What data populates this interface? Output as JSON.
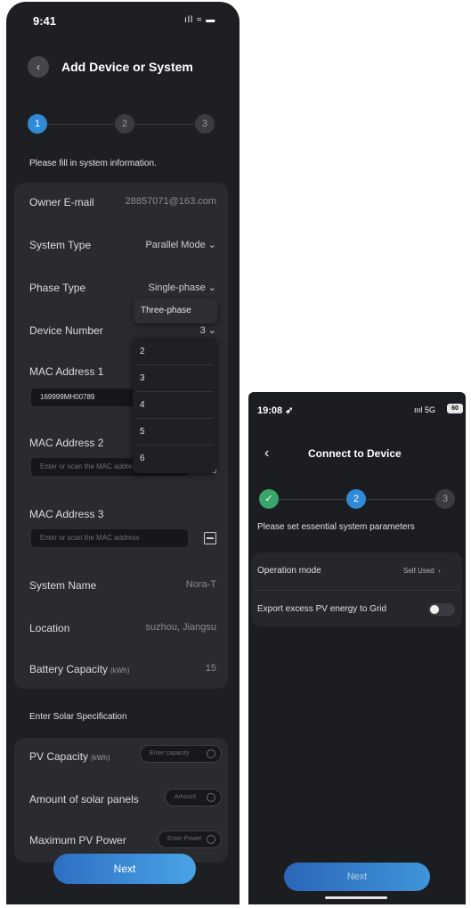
{
  "left": {
    "status": {
      "time": "9:41",
      "icons": "ıll ≈ ▬"
    },
    "header": {
      "back_icon": "‹",
      "title": "Add Device or System"
    },
    "steps": [
      "1",
      "2",
      "3"
    ],
    "hint": "Please fill in system information.",
    "fields": {
      "owner_label": "Owner E-mail",
      "owner_value": "28857071@163.com",
      "system_type_label": "System Type",
      "system_type_value": "Parallel Mode",
      "phase_type_label": "Phase Type",
      "phase_type_value": "Single-phase",
      "device_number_label": "Device Number",
      "device_number_value": "3",
      "mac1_label": "MAC Address 1",
      "mac1_value": "169999MH00789",
      "mac2_label": "MAC Address 2",
      "mac2_placeholder": "Enter or scan the MAC address",
      "mac3_label": "MAC Address 3",
      "mac3_placeholder": "Enter or scan the MAC address",
      "system_name_label": "System Name",
      "system_name_value": "Nora-T",
      "location_label": "Location",
      "location_value": "suzhou, Jiangsu",
      "battery_label": "Battery Capacity",
      "battery_unit": "(kWh)",
      "battery_value": "15"
    },
    "phase_dropdown_option": "Three-phase",
    "device_number_options": [
      "2",
      "3",
      "4",
      "5",
      "6"
    ],
    "solar": {
      "title": "Enter Solar Specification",
      "pv_label": "PV Capacity",
      "pv_unit": "(kWh)",
      "pv_placeholder": "Enter capacity",
      "panels_label": "Amount of solar panels",
      "panels_placeholder": "Amount",
      "max_power_label": "Maximum PV Power",
      "max_power_placeholder": "Enter Power"
    },
    "next": "Next"
  },
  "right": {
    "status": {
      "time": "19:08 ➶",
      "signal": "ıııl 5G",
      "battery": "60"
    },
    "header": {
      "back_icon": "‹",
      "title": "Connect to Device"
    },
    "steps": [
      "✓",
      "2",
      "3"
    ],
    "hint": "Please set essential system parameters",
    "operation_mode_label": "Operation mode",
    "operation_mode_value": "Self Used",
    "export_label": "Export excess PV energy to Grid",
    "next": "Next"
  },
  "colors": {
    "accent": "#2f8bd8",
    "background": "#1e1f22",
    "card": "#2a2b2f",
    "success": "#3aa56b"
  }
}
